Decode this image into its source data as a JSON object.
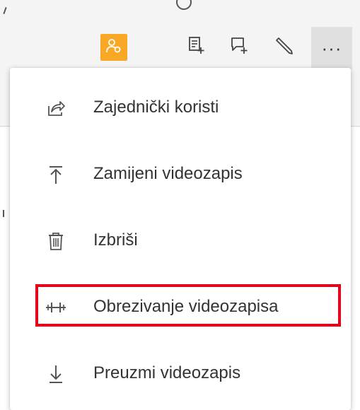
{
  "toolbar": {
    "more_label": "···",
    "icons": [
      "people-icon",
      "notes-add-icon",
      "chat-add-icon",
      "pencil-icon",
      "more-icon"
    ]
  },
  "menu": {
    "items": [
      {
        "label": "Zajednički koristi",
        "icon": "share-icon"
      },
      {
        "label": "Zamijeni videozapis",
        "icon": "upload-icon"
      },
      {
        "label": "Izbriši",
        "icon": "trash-icon"
      },
      {
        "label": "Obrezivanje videozapisa",
        "icon": "trim-icon",
        "highlighted": true
      },
      {
        "label": "Preuzmi videozapis",
        "icon": "download-icon"
      }
    ]
  },
  "colors": {
    "accent_orange": "#f9a825",
    "highlight_red": "#e3001b",
    "text": "#333333"
  }
}
